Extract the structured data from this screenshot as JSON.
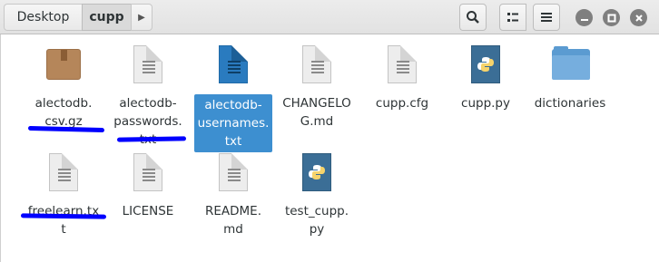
{
  "header": {
    "breadcrumbs": [
      "Desktop",
      "cupp"
    ],
    "next_arrow": "▶",
    "menu_chevron": "▾",
    "icons": {
      "search": "search-icon",
      "view": "view-grid-icon",
      "menu": "hamburger-menu-icon",
      "minimize": "minimize-icon",
      "maximize": "maximize-icon",
      "close": "close-icon"
    }
  },
  "files": [
    {
      "name": "alectodb.\ncsv.gz",
      "icon": "archive-icon",
      "underline": true
    },
    {
      "name": "alectodb-\npasswords.\ntxt",
      "icon": "text-file-icon",
      "underline": true
    },
    {
      "name": "alectodb-\nusernames.\ntxt",
      "icon": "text-file-icon",
      "selected": true
    },
    {
      "name": "CHANGELO\nG.md",
      "icon": "text-file-icon"
    },
    {
      "name": "cupp.cfg",
      "icon": "text-file-icon"
    },
    {
      "name": "cupp.py",
      "icon": "python-file-icon"
    },
    {
      "name": "dictionaries",
      "icon": "folder-icon"
    },
    {
      "name": "freelearn.txt",
      "icon": "text-file-icon",
      "underline": true
    },
    {
      "name": "LICENSE",
      "icon": "text-file-icon"
    },
    {
      "name": "README.\nmd",
      "icon": "text-file-icon"
    },
    {
      "name": "test_cupp.\npy",
      "icon": "python-file-icon"
    }
  ],
  "colors": {
    "selection": "#3d8fd0",
    "annotation_underline": "#0000ff",
    "folder": "#5b9bd1"
  }
}
